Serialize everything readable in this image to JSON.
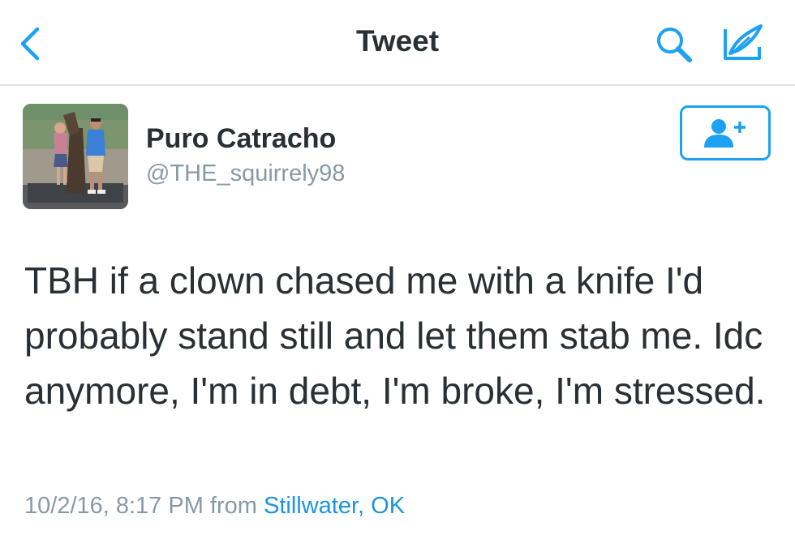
{
  "nav": {
    "title": "Tweet",
    "back_icon": "chevron-left-icon",
    "search_icon": "search-icon",
    "compose_icon": "compose-icon"
  },
  "tweet": {
    "author_name": "Puro Catracho",
    "author_handle": "@THE_squirrely98",
    "text": "TBH if a clown chased me with a knife I'd probably stand still and let them stab me. Idc anymore, I'm in debt, I'm broke, I'm stressed.",
    "timestamp": "10/2/16, 8:17 PM",
    "from_label": "from",
    "location": "Stillwater, OK"
  },
  "colors": {
    "accent": "#1da1f2",
    "text": "#292f33",
    "secondary": "#8899a6",
    "divider": "#dfe3e6"
  }
}
